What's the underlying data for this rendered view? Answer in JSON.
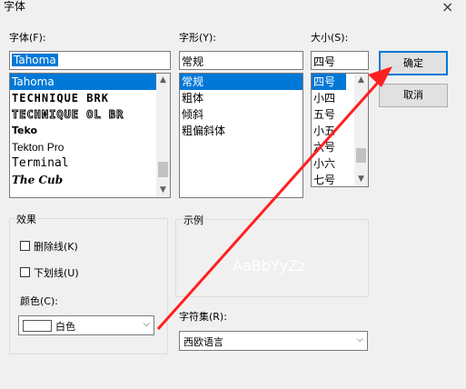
{
  "window": {
    "title": "字体",
    "close_glyph": "×"
  },
  "font": {
    "label": "字体(F):",
    "value": "Tahoma",
    "items": [
      "Tahoma",
      "TECHNIQUE BRK",
      "TECHNIQUE OL BR",
      "Teko",
      "Tekton Pro",
      "Terminal",
      "The Cub"
    ],
    "selected": "Tahoma"
  },
  "style": {
    "label": "字形(Y):",
    "value": "常规",
    "items": [
      "常规",
      "粗体",
      "倾斜",
      "粗偏斜体"
    ],
    "selected": "常规"
  },
  "size": {
    "label": "大小(S):",
    "value": "四号",
    "items": [
      "四号",
      "小四",
      "五号",
      "小五",
      "六号",
      "小六",
      "七号"
    ],
    "selected": "四号"
  },
  "buttons": {
    "ok": "确定",
    "cancel": "取消"
  },
  "effects": {
    "label": "效果",
    "strikeout": "删除线(K)",
    "underline": "下划线(U)",
    "color_label": "颜色(C):",
    "color_value": "白色"
  },
  "sample": {
    "label": "示例",
    "text": "AaBbYyZz"
  },
  "script": {
    "label": "字符集(R):",
    "value": "西欧语言"
  },
  "icons": {
    "scroll_up": "▲",
    "scroll_down": "▼",
    "dropdown": "⌵"
  },
  "colors": {
    "selection": "#0078d7",
    "annotation_arrow": "#ff2020",
    "dialog_bg": "#f0f0f0"
  }
}
